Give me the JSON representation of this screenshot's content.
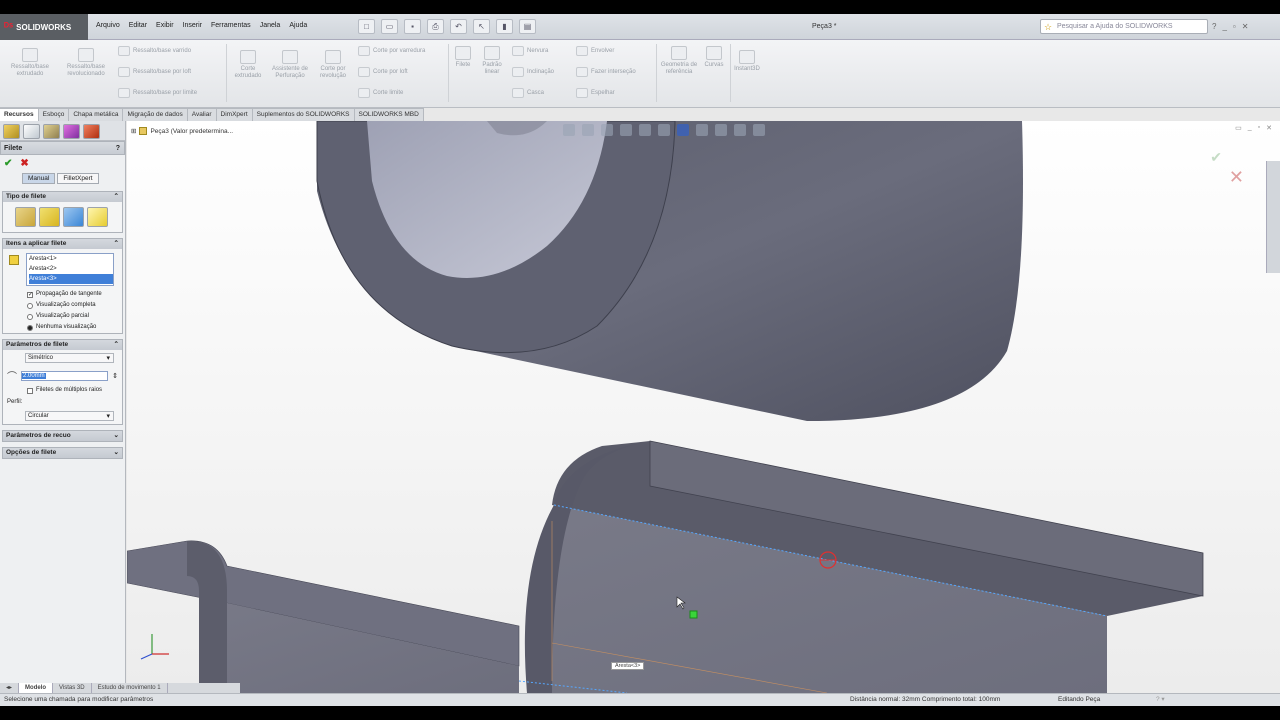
{
  "app": {
    "brand": "SOLIDWORKS",
    "document_title": "Peça3 *"
  },
  "menus": [
    "Arquivo",
    "Editar",
    "Exibir",
    "Inserir",
    "Ferramentas",
    "Janela",
    "Ajuda"
  ],
  "help_search": {
    "placeholder": "Pesquisar a Ajuda do SOLIDWORKS"
  },
  "ribbon": {
    "extrude_boss": "Ressalto/base extrudado",
    "revolve_boss": "Ressalto/base revolucionado",
    "swept_boss": "Ressalto/base varrido",
    "loft_boss": "Ressalto/base por loft",
    "boundary_boss": "Ressalto/base por limite",
    "extruded_cut": "Corte extrudado",
    "hole_wizard": "Assistente de Perfuração",
    "revolved_cut": "Corte por revolução",
    "swept_cut": "Corte por varredura",
    "lofted_cut": "Corte por loft",
    "boundary_cut": "Corte limite",
    "fillet": "Filete",
    "linear_pattern": "Padrão linear",
    "rib": "Nervura",
    "draft": "Inclinação",
    "shell": "Casca",
    "wrap": "Envolver",
    "intersect": "Fazer interseção",
    "mirror": "Espelhar",
    "ref_geometry": "Geometria de referência",
    "curves": "Curvas",
    "instant3d": "Instant3D"
  },
  "command_tabs": [
    "Recursos",
    "Esboço",
    "Chapa metálica",
    "Migração de dados",
    "Avaliar",
    "DimXpert",
    "Suplementos do SOLIDWORKS",
    "SOLIDWORKS MBD"
  ],
  "tree": {
    "part_label": "Peça3 (Valor predetermina..."
  },
  "fillet_panel": {
    "title": "Filete",
    "mode_manual": "Manual",
    "mode_filletxpert": "FilletXpert",
    "section_type": "Tipo de filete",
    "section_items": "Itens a aplicar filete",
    "edges": [
      "Aresta<1>",
      "Aresta<2>",
      "Aresta<3>"
    ],
    "tangent_propagation": "Propagação de tangente",
    "preview_full": "Visualização completa",
    "preview_partial": "Visualização parcial",
    "preview_none": "Nenhuma visualização",
    "section_params": "Parâmetros de filete",
    "param_type": "Simétrico",
    "radius_value": "2.00mm",
    "multi_radius": "Filetes de múltiplos raios",
    "profile_label": "Perfil:",
    "profile_value": "Circular",
    "section_setback": "Parâmetros de recuo",
    "section_options": "Opções de filete"
  },
  "viewport": {
    "tooltip": "Aresta<3>"
  },
  "bottom_tabs": [
    "Modelo",
    "Vistas 3D",
    "Estudo de movimento 1"
  ],
  "status": {
    "left": "Selecione uma chamada para modificar parâmetros",
    "measure": "Distância normal: 32mm Comprimento total: 100mm",
    "mode": "Editando Peça"
  }
}
